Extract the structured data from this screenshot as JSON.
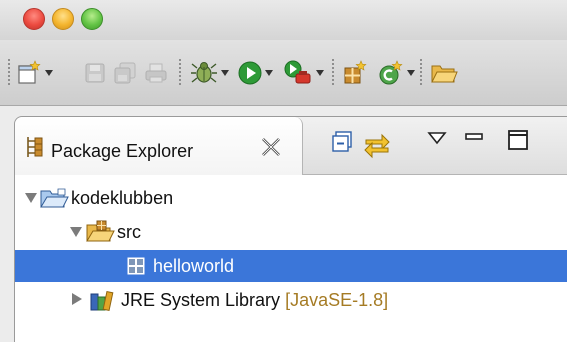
{
  "window": {
    "buttons": [
      "close",
      "minimize",
      "zoom"
    ]
  },
  "toolbar": {
    "groups": [
      [
        "new-wizard-icon",
        "save-icon",
        "save-all-icon",
        "print-icon"
      ],
      [
        "debug-icon",
        "run-icon",
        "external-tools-icon"
      ],
      [
        "new-java-package-icon",
        "new-java-class-icon"
      ],
      [
        "open-folder-icon"
      ]
    ]
  },
  "view": {
    "tab_label": "Package Explorer",
    "tab_icon": "package-explorer-icon",
    "controls": [
      "collapse-all-icon",
      "link-with-editor-icon",
      "view-menu-icon",
      "minimize-icon",
      "maximize-icon"
    ]
  },
  "tree": {
    "project": {
      "label": "kodeklubben",
      "expanded": true
    },
    "src": {
      "label": "src",
      "expanded": true
    },
    "package": {
      "label": "helloworld",
      "selected": true
    },
    "library": {
      "label": "JRE System Library",
      "decoration": "[JavaSE-1.8]",
      "expanded": false
    }
  },
  "colors": {
    "selection": "#3b76d9",
    "decoration": "#a57b24"
  }
}
